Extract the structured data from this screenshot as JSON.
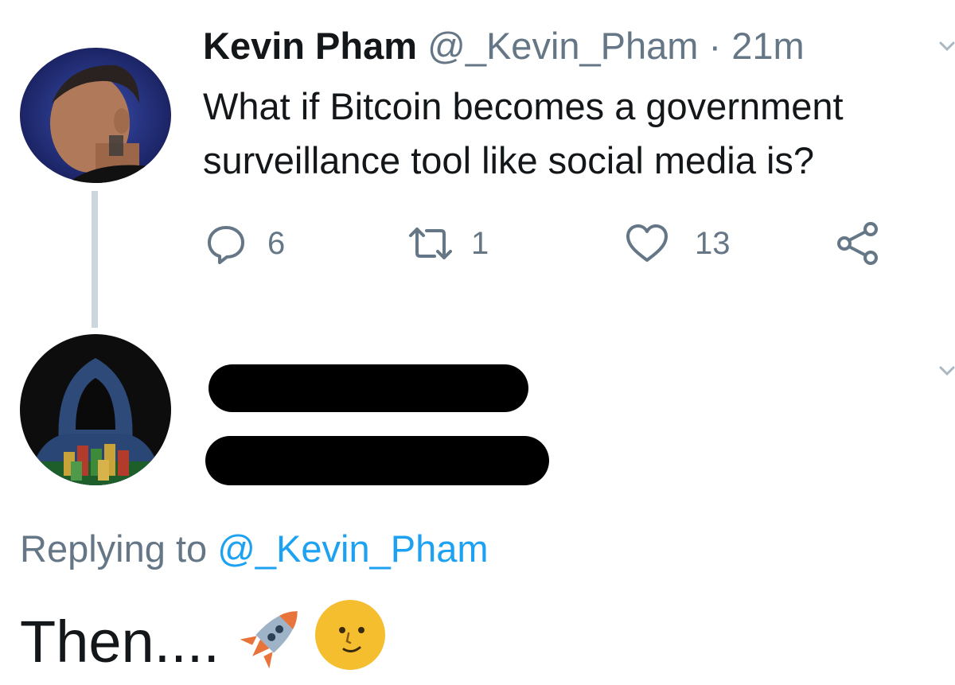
{
  "tweet": {
    "author_name": "Kevin Pham",
    "handle": "@_Kevin_Pham",
    "separator": "·",
    "time": "21m",
    "text": "What if Bitcoin becomes a government surveillance tool like social media is?",
    "actions": {
      "reply_count": "6",
      "retweet_count": "1",
      "like_count": "13"
    },
    "icons": {
      "reply": "reply-icon",
      "retweet": "retweet-icon",
      "like": "heart-icon",
      "share": "share-icon",
      "more": "chevron-down-icon"
    }
  },
  "reply": {
    "replying_prefix": "Replying to",
    "replying_mention": "@_Kevin_Pham",
    "text": "Then....",
    "emojis": [
      "rocket-emoji",
      "full-moon-face-emoji"
    ],
    "author_redacted": true
  },
  "colors": {
    "text": "#14171a",
    "secondary": "#657786",
    "link": "#1da1f2",
    "thread_line": "#ccd6dd"
  }
}
